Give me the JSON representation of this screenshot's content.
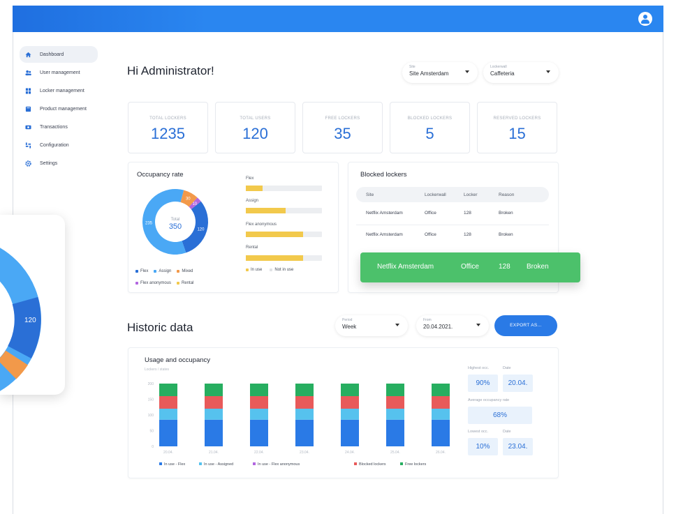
{
  "greeting": "Hi Administrator!",
  "filters": {
    "site": {
      "label": "Site",
      "value": "Site Amsterdam"
    },
    "lockerwall": {
      "label": "Lockerwall",
      "value": "Caffeteria"
    }
  },
  "sidebar": {
    "items": [
      {
        "label": "Dashboard",
        "icon": "home-icon"
      },
      {
        "label": "User management",
        "icon": "users-icon"
      },
      {
        "label": "Locker management",
        "icon": "locker-icon"
      },
      {
        "label": "Product management",
        "icon": "product-icon"
      },
      {
        "label": "Transactions",
        "icon": "transactions-icon"
      },
      {
        "label": "Configuration",
        "icon": "configuration-icon"
      },
      {
        "label": "Settings",
        "icon": "gear-icon"
      }
    ]
  },
  "stats": [
    {
      "title": "TOTAL LOCKERS",
      "value": "1235"
    },
    {
      "title": "TOTAL USERS",
      "value": "120"
    },
    {
      "title": "FREE LOCKERS",
      "value": "35"
    },
    {
      "title": "BLOCKED LOCKERS",
      "value": "5"
    },
    {
      "title": "RESERVED LOCKERS",
      "value": "15"
    }
  ],
  "occupancy": {
    "title": "Occupancy rate",
    "center_label": "Total",
    "center_value": "350",
    "slices": [
      {
        "name": "Flex",
        "value": 120,
        "label": "120",
        "color": "#2a6fd6"
      },
      {
        "name": "Assign",
        "value": 235,
        "label": "235",
        "color": "#4aa8f5"
      },
      {
        "name": "Mixed",
        "value": 30,
        "label": "30",
        "color": "#f2994a"
      },
      {
        "name": "Flex anonymous",
        "value": 10,
        "label": "10",
        "color": "#b266e0"
      }
    ],
    "legend": [
      "Flex",
      "Assign",
      "Mixed",
      "Flex anonymous",
      "Rental"
    ],
    "legend_colors": [
      "#2a6fd6",
      "#4aa8f5",
      "#f2994a",
      "#b266e0",
      "#f2c94c"
    ],
    "bars": [
      {
        "label": "Flex",
        "fill": 0.22
      },
      {
        "label": "Assign",
        "fill": 0.52
      },
      {
        "label": "Flex anonymous",
        "fill": 0.75
      },
      {
        "label": "Rental",
        "fill": 0.75
      }
    ],
    "bar_legend": [
      "In use",
      "Not in use"
    ]
  },
  "blocked": {
    "title": "Blocked lockers",
    "headers": [
      "Site",
      "Lockerwall",
      "Locker",
      "Reason"
    ],
    "rows": [
      [
        "Netflix Amsterdam",
        "Office",
        "128",
        "Broken"
      ],
      [
        "Netflix Amsterdam",
        "Office",
        "128",
        "Broken"
      ]
    ],
    "toast": [
      "Netflix Amsterdam",
      "Office",
      "128",
      "Broken"
    ]
  },
  "historic": {
    "title": "Historic data",
    "period": {
      "label": "Period",
      "value": "Week"
    },
    "from": {
      "label": "From",
      "value": "20.04.2021."
    },
    "export_label": "EXPORT AS...",
    "chart_title": "Usage and occupancy",
    "ylabel": "Lockers / states"
  },
  "chart_data": {
    "type": "bar",
    "stacked": true,
    "title": "Usage and occupancy",
    "ylabel": "Lockers / states",
    "categories": [
      "20.04.",
      "21.04.",
      "22.04.",
      "23.04.",
      "24.04.",
      "25.04.",
      "26.04."
    ],
    "yticks": [
      0,
      50,
      100,
      150,
      200
    ],
    "ylim": [
      0,
      200
    ],
    "series": [
      {
        "name": "In use - Flex",
        "color": "#2a7ae6",
        "values": [
          85,
          85,
          85,
          85,
          85,
          85,
          85
        ]
      },
      {
        "name": "In use - Assigned",
        "color": "#56c2ee",
        "values": [
          35,
          35,
          35,
          35,
          35,
          35,
          35
        ]
      },
      {
        "name": "In use - Flex anonymous",
        "color": "#b266e0",
        "values": [
          0,
          0,
          0,
          0,
          0,
          0,
          0
        ]
      },
      {
        "name": "Blocked lockers",
        "color": "#e85a5a",
        "values": [
          40,
          40,
          40,
          40,
          40,
          40,
          40
        ]
      },
      {
        "name": "Free lockers",
        "color": "#27ae60",
        "values": [
          40,
          40,
          40,
          40,
          40,
          40,
          40
        ]
      }
    ]
  },
  "side_stats": {
    "highest_label": "Highest occ.",
    "date_label": "Date",
    "highest_value": "90%",
    "highest_date": "20.04.",
    "avg_label": "Average occupancy rate",
    "avg_value": "68%",
    "lowest_label": "Lowest occ.",
    "lowest_value": "10%",
    "lowest_date": "23.04."
  },
  "zoom_value": "120"
}
